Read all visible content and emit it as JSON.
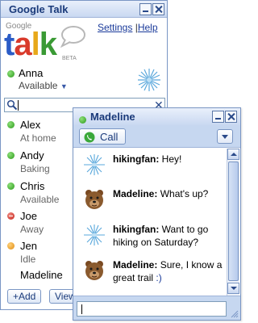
{
  "main_window": {
    "title": "Google Talk",
    "logo": {
      "google_text": "Google",
      "talk_t": "t",
      "talk_a": "a",
      "talk_l": "l",
      "talk_k": "k",
      "beta_text": "BETA"
    },
    "links": {
      "settings": "Settings",
      "separator": "|",
      "help": "Help"
    },
    "self": {
      "name": "Anna",
      "status": "Available",
      "status_arrow": "▼"
    },
    "search": {
      "value": "",
      "clear_icon": "✕"
    },
    "contacts": [
      {
        "name": "Alex",
        "status": "At home",
        "presence": "green"
      },
      {
        "name": "Andy",
        "status": "Baking",
        "presence": "green"
      },
      {
        "name": "Chris",
        "status": "Available",
        "presence": "green"
      },
      {
        "name": "Joe",
        "status": "Away",
        "presence": "red"
      },
      {
        "name": "Jen",
        "status": "Idle",
        "presence": "orange"
      },
      {
        "name": "Madeline",
        "status": "",
        "presence": ""
      }
    ],
    "buttons": {
      "add": "+Add",
      "view": "View"
    }
  },
  "chat_window": {
    "title": "Madeline",
    "call_label": "Call",
    "messages": [
      {
        "sender": "hikingfan:",
        "text": "Hey!",
        "avatar": "snowflake-avatar"
      },
      {
        "sender": "Madeline:",
        "text": "What's up?",
        "avatar": "bear-avatar"
      },
      {
        "sender": "hikingfan:",
        "text": "Want to go hiking on Saturday?",
        "avatar": "snowflake-avatar"
      },
      {
        "sender": "Madeline:",
        "text": "Sure, I know a great trail",
        "smiley": ":)",
        "avatar": "bear-avatar"
      }
    ],
    "input_value": ""
  },
  "colors": {
    "titlebar_text": "#1a3a7a",
    "link": "#1a3a9a",
    "available": "#2a9a1a",
    "busy": "#c42018",
    "idle": "#e08a10",
    "chat_toolbar": "#c6d7f0"
  },
  "icons": {
    "presence": "dot",
    "call": "phone-icon",
    "search": "magnifier-icon",
    "self_avatar": "snowflake-icon"
  }
}
